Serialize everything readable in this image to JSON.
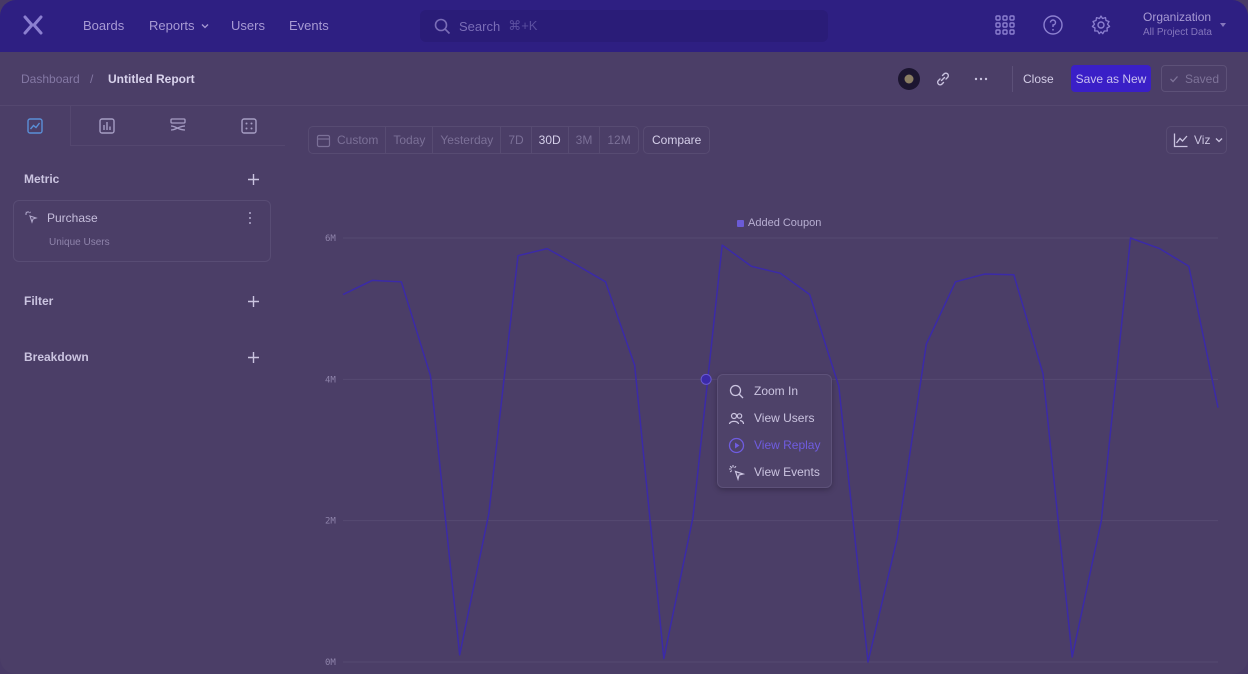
{
  "nav": {
    "links": [
      "Boards",
      "Reports",
      "Users",
      "Events"
    ],
    "search_placeholder": "Search",
    "search_shortcut": "⌘+K",
    "org_name": "Organization",
    "org_sub": "All Project Data"
  },
  "header": {
    "breadcrumb_root": "Dashboard",
    "breadcrumb_sep": "/",
    "title": "Untitled Report",
    "close_label": "Close",
    "save_new_label": "Save as New",
    "saved_label": "Saved"
  },
  "left": {
    "metric_label": "Metric",
    "metric_name": "Purchase",
    "metric_sub": "Unique Users",
    "filter_label": "Filter",
    "breakdown_label": "Breakdown"
  },
  "range": {
    "items": [
      "Custom",
      "Today",
      "Yesterday",
      "7D",
      "30D",
      "3M",
      "12M"
    ],
    "selected": "30D",
    "compare_label": "Compare",
    "viz_label": "Viz"
  },
  "menu": {
    "items": [
      "Zoom In",
      "View Users",
      "View Replay",
      "View Events"
    ],
    "highlighted": "View Replay"
  },
  "colors": {
    "nav_bg": "#2e1f82",
    "accent": "#3a1fc7",
    "series": "#3b2aa8",
    "overlay_bg": "#4b3e67"
  },
  "chart_data": {
    "type": "line",
    "series": [
      {
        "name": "Added Coupon",
        "values": [
          5.2,
          5.4,
          5.38,
          4.05,
          0.1,
          2.1,
          5.75,
          5.85,
          5.62,
          5.38,
          4.2,
          0.05,
          2.05,
          5.9,
          5.6,
          5.5,
          5.2,
          3.9,
          0.0,
          1.75,
          4.5,
          5.38,
          5.49,
          5.48,
          4.08,
          0.07,
          2.0,
          6.0,
          5.85,
          5.6,
          3.6
        ]
      }
    ],
    "ylim": [
      0,
      6
    ],
    "yticks": [
      "0M",
      "2M",
      "4M",
      "6M"
    ],
    "legend": "top-center",
    "hover_index": 13,
    "hover_value": 4.0,
    "grid": true
  }
}
